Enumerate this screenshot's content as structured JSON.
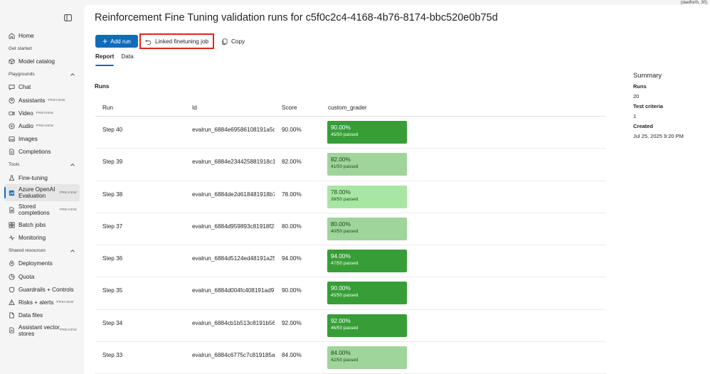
{
  "sidebar": {
    "items": [
      {
        "key": "home",
        "label": "Home",
        "icon": "home-icon"
      },
      {
        "key": "section-get-started",
        "section": "Get started"
      },
      {
        "key": "model-catalog",
        "label": "Model catalog",
        "icon": "cube-icon"
      },
      {
        "key": "section-playgrounds",
        "section": "Playgrounds",
        "collapsible": true
      },
      {
        "key": "chat",
        "label": "Chat",
        "icon": "chat-icon"
      },
      {
        "key": "assistants",
        "label": "Assistants",
        "icon": "assistant-icon",
        "badge": "PREVIEW"
      },
      {
        "key": "video",
        "label": "Video",
        "icon": "video-icon",
        "badge": "PREVIEW"
      },
      {
        "key": "audio",
        "label": "Audio",
        "icon": "audio-icon",
        "badge": "PREVIEW"
      },
      {
        "key": "images",
        "label": "Images",
        "icon": "image-icon"
      },
      {
        "key": "completions",
        "label": "Completions",
        "icon": "completions-icon"
      },
      {
        "key": "section-tools",
        "section": "Tools",
        "collapsible": true
      },
      {
        "key": "fine-tuning",
        "label": "Fine-tuning",
        "icon": "flask-icon"
      },
      {
        "key": "azure-openai-evaluation",
        "label": "Azure OpenAI Evaluation",
        "icon": "evaluation-icon",
        "badge": "PREVIEW",
        "active": true,
        "tall": true
      },
      {
        "key": "stored-completions",
        "label": "Stored completions",
        "icon": "stored-icon",
        "badge": "PREVIEW",
        "tall": true
      },
      {
        "key": "batch-jobs",
        "label": "Batch jobs",
        "icon": "batch-icon"
      },
      {
        "key": "monitoring",
        "label": "Monitoring",
        "icon": "monitor-icon"
      },
      {
        "key": "section-shared-resources",
        "section": "Shared resources",
        "collapsible": true
      },
      {
        "key": "deployments",
        "label": "Deployments",
        "icon": "deploy-icon"
      },
      {
        "key": "quota",
        "label": "Quota",
        "icon": "quota-icon"
      },
      {
        "key": "guardrails",
        "label": "Guardrails + Controls",
        "icon": "shield-icon"
      },
      {
        "key": "risks",
        "label": "Risks + alerts",
        "icon": "alert-icon",
        "badge": "PREVIEW"
      },
      {
        "key": "data-files",
        "label": "Data files",
        "icon": "file-icon"
      },
      {
        "key": "assistant-vector-stores",
        "label": "Assistant vector stores",
        "icon": "vector-store-icon",
        "badge": "PREVIEW",
        "tall": true
      }
    ]
  },
  "topright_text": "(daelforth, 30)",
  "header": {
    "title": "Reinforcement Fine Tuning validation runs for c5f0c2c4-4168-4b76-8174-bbc520e0b75d"
  },
  "toolbar": {
    "add_run": "Add run",
    "linked_job": "Linked finetuning job",
    "copy": "Copy"
  },
  "tabs": [
    {
      "label": "Report",
      "selected": true
    },
    {
      "label": "Data",
      "selected": false
    }
  ],
  "runs_heading": "Runs",
  "table": {
    "headers": {
      "run": "Run",
      "id": "Id",
      "score": "Score",
      "grader": "custom_grader"
    },
    "rows": [
      {
        "run": "Step 40",
        "id": "evalrun_6884e69586108191a5cc",
        "score": "90.00%",
        "grade_pct": "90.00%",
        "grade_passed": "45/50 passed",
        "grade_color": "#379e37",
        "grade_text": "#ffffff"
      },
      {
        "run": "Step 39",
        "id": "evalrun_6884e234425881918c1a",
        "score": "82.00%",
        "grade_pct": "82.00%",
        "grade_passed": "41/50 passed",
        "grade_color": "#9fd49a",
        "grade_text": "#1a4a1a"
      },
      {
        "run": "Step 38",
        "id": "evalrun_6884de2d618481918b78",
        "score": "78.00%",
        "grade_pct": "78.00%",
        "grade_passed": "39/50 passed",
        "grade_color": "#a8e6a3",
        "grade_text": "#1a4a1a"
      },
      {
        "run": "Step 37",
        "id": "evalrun_6884d959893c81918f23",
        "score": "80.00%",
        "grade_pct": "80.00%",
        "grade_passed": "40/50 passed",
        "grade_color": "#9fd49a",
        "grade_text": "#1a4a1a"
      },
      {
        "run": "Step 36",
        "id": "evalrun_6884d5124ed48191a252",
        "score": "94.00%",
        "grade_pct": "94.00%",
        "grade_passed": "47/50 passed",
        "grade_color": "#379e37",
        "grade_text": "#ffffff"
      },
      {
        "run": "Step 35",
        "id": "evalrun_6884d004fc408191ad97",
        "score": "90.00%",
        "grade_pct": "90.00%",
        "grade_passed": "45/50 passed",
        "grade_color": "#379e37",
        "grade_text": "#ffffff"
      },
      {
        "run": "Step 34",
        "id": "evalrun_6884cb1b513c8191b563",
        "score": "92.00%",
        "grade_pct": "92.00%",
        "grade_passed": "46/50 passed",
        "grade_color": "#379e37",
        "grade_text": "#ffffff"
      },
      {
        "run": "Step 33",
        "id": "evalrun_6884c6775c7c819185a8",
        "score": "84.00%",
        "grade_pct": "84.00%",
        "grade_passed": "42/50 passed",
        "grade_color": "#9fd49a",
        "grade_text": "#1a4a1a"
      }
    ]
  },
  "summary": {
    "title": "Summary",
    "runs_label": "Runs",
    "runs_value": "20",
    "criteria_label": "Test criteria",
    "criteria_value": "1",
    "created_label": "Created",
    "created_value": "Jul 25, 2025 9:20 PM"
  },
  "colors": {
    "accent": "#0f6cbd",
    "highlight_border": "#e0271b"
  }
}
